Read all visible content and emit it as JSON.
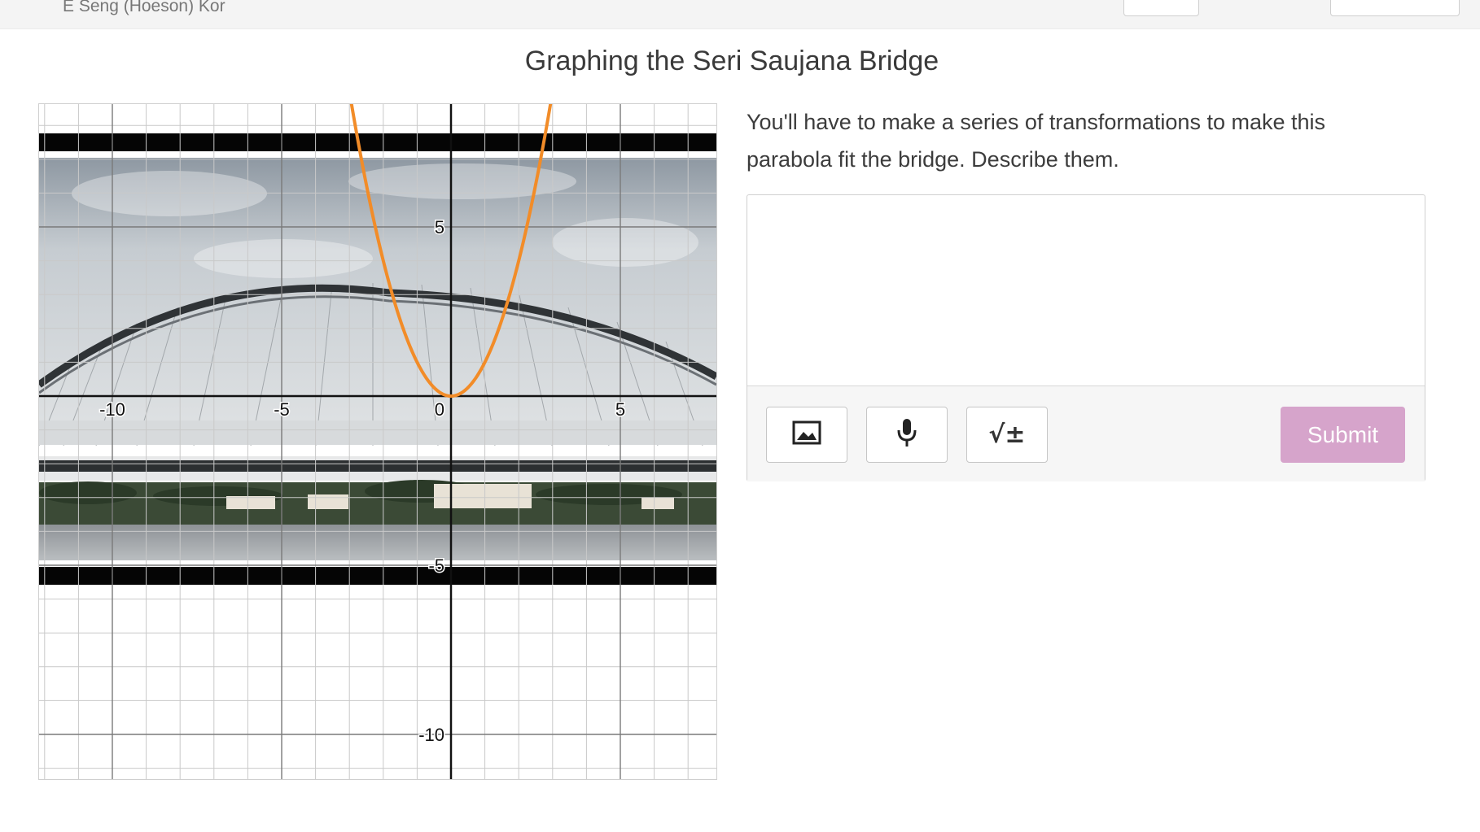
{
  "header": {
    "student_name": "E Seng (Hoeson) Kor"
  },
  "title": "Graphing the Seri Saujana Bridge",
  "graph": {
    "x_tick_labels": [
      "-10",
      "-5",
      "0",
      "5"
    ],
    "y_tick_labels": [
      "5",
      "-5",
      "-10"
    ],
    "curve_color": "#f28c28",
    "background_image": "seri-saujana-bridge-photo"
  },
  "question": {
    "prompt": "You'll have to make a series of transformations to make this parabola fit the bridge.  Describe them.",
    "answer_value": "",
    "tools": [
      "image-icon",
      "microphone-icon",
      "math-icon"
    ],
    "math_icon_text": "√±",
    "submit_label": "Submit",
    "submit_color": "#d6a4cb"
  }
}
